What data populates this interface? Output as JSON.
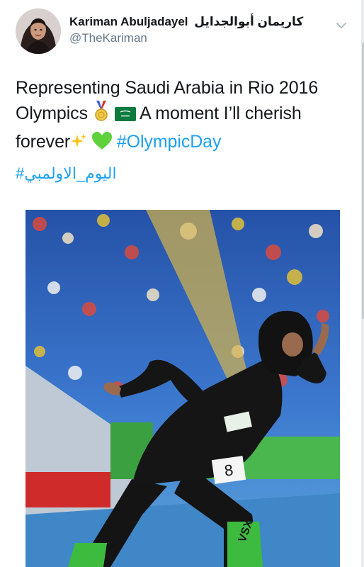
{
  "tweet": {
    "display_name_latin": "Kariman Abuljadayel",
    "display_name_arabic": "كاريمان أبوالجدايل",
    "handle": "@TheKariman",
    "text": {
      "line1": "Representing Saudi Arabia in Rio 2016",
      "line2_a": "Olympics",
      "line2_b": "A moment I’ll cherish",
      "line3_a": "forever",
      "hashtag_en": "#OlympicDay",
      "hashtag_ar": "#اليوم_الاولمبي"
    },
    "emojis": [
      "medal-icon",
      "saudi-flag-icon",
      "sparkles-icon",
      "green-heart-icon"
    ]
  },
  "photo": {
    "bib_number": "8",
    "shoe_text": "VSX",
    "subject": "sprinter in black hijab at starting blocks"
  },
  "colors": {
    "link_blue": "#1da1f2",
    "handle_gray": "#657786",
    "heart_green": "#5fd13b",
    "track_blue": "#2a63b8"
  }
}
